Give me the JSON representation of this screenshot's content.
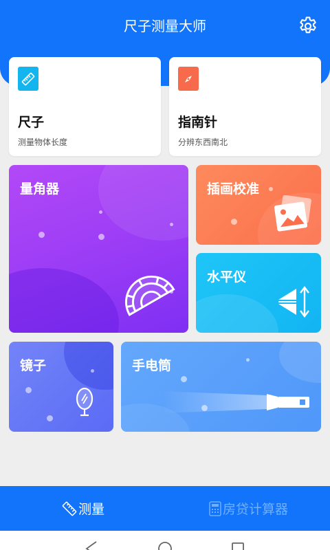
{
  "app": {
    "title": "尺子测量大师"
  },
  "colors": {
    "brand": "#1273fb",
    "ruler_icon": "#14b4ef",
    "compass_icon": "#f76a4b",
    "protractor_card": "#9b3cf5",
    "calibrate_card": "#fd7b53",
    "level_card": "#19c0f7",
    "mirror_card": "#6a7af6",
    "flashlight_card": "#5aa0fb"
  },
  "header": {
    "settings_icon": "gear-icon"
  },
  "tools": {
    "ruler": {
      "title": "尺子",
      "subtitle": "测量物体长度",
      "icon": "ruler-icon"
    },
    "compass": {
      "title": "指南针",
      "subtitle": "分辨东西南北",
      "icon": "compass-icon"
    },
    "protractor": {
      "title": "量角器",
      "icon": "protractor-icon"
    },
    "calibrate": {
      "title": "插画校准",
      "icon": "picture-icon"
    },
    "level": {
      "title": "水平仪",
      "icon": "level-icon"
    },
    "mirror": {
      "title": "镜子",
      "icon": "mirror-icon"
    },
    "flashlight": {
      "title": "手电筒",
      "icon": "flashlight-icon"
    }
  },
  "nav": {
    "measure": {
      "label": "测量",
      "icon": "ruler-icon",
      "active": true
    },
    "mortgage": {
      "label": "房贷计算器",
      "icon": "calculator-icon",
      "active": false
    }
  },
  "system_nav": [
    "back-icon",
    "home-icon",
    "recents-icon"
  ]
}
